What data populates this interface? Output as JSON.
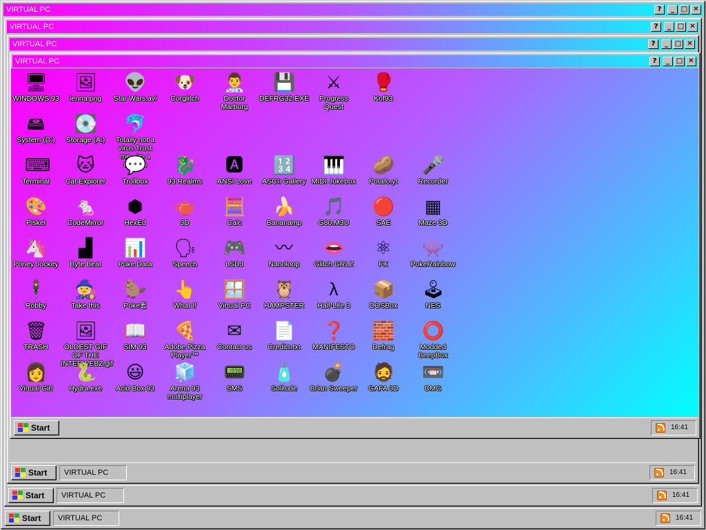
{
  "windows": [
    {
      "title": "VIRTUAL PC",
      "task_label": "VIRTUAL PC",
      "start_label": "Start",
      "clock": "16:41"
    },
    {
      "title": "VIRTUAL PC",
      "task_label": "VIRTUAL PC",
      "start_label": "Start",
      "clock": "16:41"
    },
    {
      "title": "VIRTUAL PC",
      "task_label": "VIRTUAL PC",
      "start_label": "Start",
      "clock": "16:41"
    },
    {
      "title": "VIRTUAL PC",
      "task_label": "VIRTUAL PC",
      "start_label": "Start",
      "clock": "16:41"
    }
  ],
  "titlebar_buttons": {
    "help": "?",
    "minimize": "_",
    "maximize": "□",
    "close": "✕"
  },
  "inner_taskbar": {
    "start_label": "Start",
    "clock": "16:41"
  },
  "colors": {
    "title_gradient": [
      "#ff00ff",
      "#b35cff",
      "#00ffff"
    ],
    "chrome": "#c0c0c0"
  },
  "desktop_icons": [
    [
      {
        "name": "windows-93-icon",
        "label": "WINDOWS 93",
        "glyph": "🖥"
      },
      {
        "name": "lenna-icon",
        "label": "lenna.png",
        "glyph": "🖼"
      },
      {
        "name": "star-wars-icon",
        "label": "Star Wars.avi",
        "glyph": "👽"
      },
      {
        "name": "corglitch-icon",
        "label": "Corglitch",
        "glyph": "🐶"
      },
      {
        "name": "doctor-marburg-icon",
        "label": "Doctor Marburg",
        "glyph": "👨‍⚕️"
      },
      {
        "name": "defrag32-icon",
        "label": "DEFRG32.EXE",
        "glyph": "💾"
      },
      {
        "name": "progress-quest-icon",
        "label": "Progress Quest",
        "glyph": "⚔"
      },
      {
        "name": "kof93-icon",
        "label": "Kof93",
        "glyph": "🥊"
      }
    ],
    [
      {
        "name": "system-drive-icon",
        "label": "System (C:)",
        "glyph": "🖴"
      },
      {
        "name": "storage-drive-icon",
        "label": "Storage (A:)",
        "glyph": "💽"
      },
      {
        "name": "not-a-virus-icon",
        "label": "Totally not a virus.Trust me...im a dolphin",
        "glyph": "🐬"
      }
    ],
    [
      {
        "name": "terminal-icon",
        "label": "Terminal",
        "glyph": "⌨"
      },
      {
        "name": "cat-explorer-icon",
        "label": "Cat Explorer",
        "glyph": "🐱"
      },
      {
        "name": "trollbox-icon",
        "label": "Trollbox",
        "glyph": "💬"
      },
      {
        "name": "93-realms-icon",
        "label": "93 Realms",
        "glyph": "🐉"
      },
      {
        "name": "ansi-love-icon",
        "label": "ANSI Love",
        "glyph": "🅰"
      },
      {
        "name": "ascii-gallery-icon",
        "label": "ASCII Gallery",
        "glyph": "🔢"
      },
      {
        "name": "midi-jukebox-icon",
        "label": "MIDI Jukebox",
        "glyph": "🎹"
      },
      {
        "name": "potato-yt-icon",
        "label": "Potato.yt",
        "glyph": "🥔"
      },
      {
        "name": "recorder-icon",
        "label": "Recorder",
        "glyph": "🎤"
      }
    ],
    [
      {
        "name": "piskel-icon",
        "label": "Piskel",
        "glyph": "🎨"
      },
      {
        "name": "codemirror-icon",
        "label": "CodeMirror",
        "glyph": "🐁"
      },
      {
        "name": "hexed-icon",
        "label": "HexEd",
        "glyph": "⬢"
      },
      {
        "name": "3d-icon",
        "label": "3D",
        "glyph": "🫖"
      },
      {
        "name": "calc-icon",
        "label": "Calc",
        "glyph": "🧮"
      },
      {
        "name": "bananamp-icon",
        "label": "Bananamp",
        "glyph": "🍌"
      },
      {
        "name": "g80m3u-icon",
        "label": "G80.M3U",
        "glyph": "🎵"
      },
      {
        "name": "sae-icon",
        "label": "SAE",
        "glyph": "🔴"
      },
      {
        "name": "maze-3d-icon",
        "label": "Maze 3D",
        "glyph": "▦"
      }
    ],
    [
      {
        "name": "poney-jockey-icon",
        "label": "Poney Jockey",
        "glyph": "🦄"
      },
      {
        "name": "byte-beat-icon",
        "label": "Byte Beat",
        "glyph": "▟"
      },
      {
        "name": "puke-data-icon",
        "label": "Puke Data",
        "glyph": "📊"
      },
      {
        "name": "speech-icon",
        "label": "Speech",
        "glyph": "🗣"
      },
      {
        "name": "lsdj-icon",
        "label": "LSDJ",
        "glyph": "🎮"
      },
      {
        "name": "nanoloop-icon",
        "label": "Nanoloop",
        "glyph": "〰"
      },
      {
        "name": "glitch-grlz-icon",
        "label": "Glitch GRLZ",
        "glyph": "👄"
      },
      {
        "name": "fx-icon",
        "label": "FX",
        "glyph": "⚛"
      },
      {
        "name": "pokerainbow-icon",
        "label": "PokeRainbow",
        "glyph": "👾"
      }
    ],
    [
      {
        "name": "robby-icon",
        "label": "Robby",
        "glyph": "🕴"
      },
      {
        "name": "take-this-icon",
        "label": "Take this",
        "glyph": "🧙"
      },
      {
        "name": "poke-icon",
        "label": "Poke뛼",
        "glyph": "🦫"
      },
      {
        "name": "what-if-icon",
        "label": "What If",
        "glyph": "👆"
      },
      {
        "name": "virtual-pc-icon",
        "label": "Virtual PC",
        "glyph": "🪟"
      },
      {
        "name": "hampster-icon",
        "label": "HAMPSTER",
        "glyph": "🦉"
      },
      {
        "name": "half-life-3-icon",
        "label": "Half-Life 3",
        "glyph": "λ"
      },
      {
        "name": "dosbox-icon",
        "label": "DOSBox",
        "glyph": "📦"
      },
      {
        "name": "nes-icon",
        "label": "NES",
        "glyph": "🕹"
      }
    ],
    [
      {
        "name": "trash-icon",
        "label": "TRASH",
        "glyph": "🗑"
      },
      {
        "name": "oldest-gif-icon",
        "label": "OLDEST GIF OF THE INTERWEBZ.gif",
        "glyph": "🖼"
      },
      {
        "name": "sim93-icon",
        "label": "SIM 93",
        "glyph": "📖"
      },
      {
        "name": "adobe-pizza-icon",
        "label": "Adobe Pizza Player™",
        "glyph": "🍕"
      },
      {
        "name": "contact-us-icon",
        "label": "Contact us",
        "glyph": "✉"
      },
      {
        "name": "credits-icon",
        "label": "Credits.txt",
        "glyph": "📄"
      },
      {
        "name": "manifesto-icon",
        "label": "MANIFESTO",
        "glyph": "❓"
      },
      {
        "name": "defrag-icon",
        "label": "Defrag",
        "glyph": "🧱"
      },
      {
        "name": "modded-beepbox-icon",
        "label": "Modded BeepBox",
        "glyph": "⭕"
      }
    ],
    [
      {
        "name": "virtual-girl-icon",
        "label": "Virtual Girl",
        "glyph": "👩"
      },
      {
        "name": "hydra-icon",
        "label": "Hydra.exe",
        "glyph": "🐍"
      },
      {
        "name": "acid-box-icon",
        "label": "Acid Box 93",
        "glyph": "😃"
      },
      {
        "name": "arena-93-icon",
        "label": "Arena 93 multiplayer",
        "glyph": "🧊"
      },
      {
        "name": "sms-icon",
        "label": "SMS",
        "glyph": "📟"
      },
      {
        "name": "solitude-icon",
        "label": "Solitude",
        "glyph": "🧴"
      },
      {
        "name": "brian-sweeper-icon",
        "label": "Brian Sweeper",
        "glyph": "💣"
      },
      {
        "name": "gafa-3d-icon",
        "label": "GAFA 3D",
        "glyph": "🧔"
      },
      {
        "name": "dmg-icon",
        "label": "DMG",
        "glyph": "📼"
      }
    ]
  ]
}
